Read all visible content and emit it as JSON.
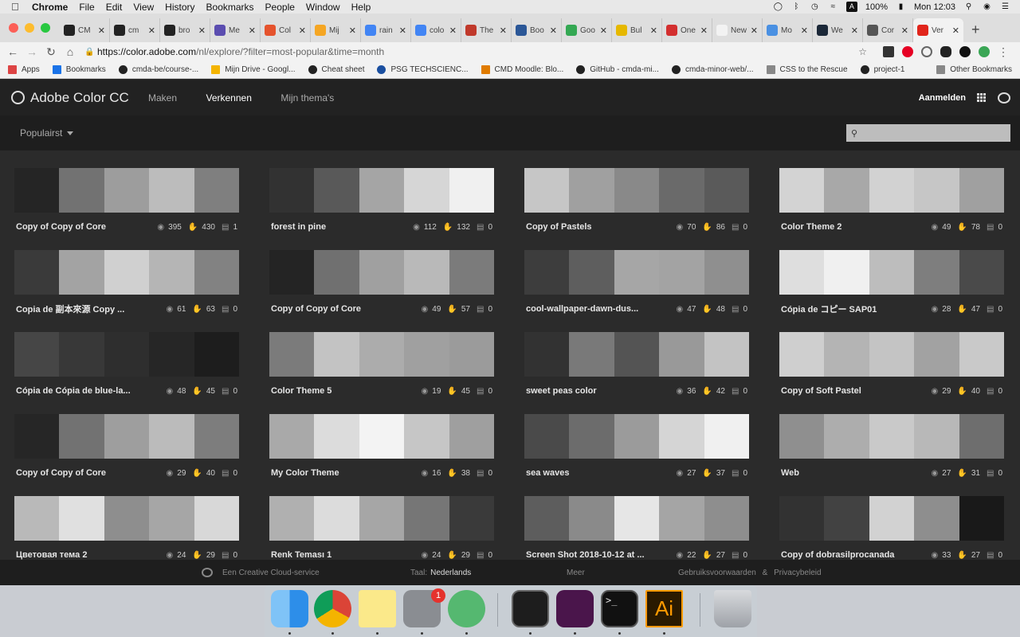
{
  "menubar": {
    "app": "Chrome",
    "items": [
      "File",
      "Edit",
      "View",
      "History",
      "Bookmarks",
      "People",
      "Window",
      "Help"
    ],
    "battery": "100%",
    "clock": "Mon 12:03"
  },
  "tabs": [
    {
      "label": "CM",
      "color": "#222"
    },
    {
      "label": "cm",
      "color": "#222"
    },
    {
      "label": "bro",
      "color": "#222"
    },
    {
      "label": "Me",
      "color": "#5b4db0"
    },
    {
      "label": "Col",
      "color": "#e5532d"
    },
    {
      "label": "Mij",
      "color": "#f5a623"
    },
    {
      "label": "rain",
      "color": "#4285f4"
    },
    {
      "label": "colo",
      "color": "#4285f4"
    },
    {
      "label": "The",
      "color": "#c0392b"
    },
    {
      "label": "Boo",
      "color": "#2b5797"
    },
    {
      "label": "Goo",
      "color": "#34a853"
    },
    {
      "label": "Bul",
      "color": "#e6b800"
    },
    {
      "label": "One",
      "color": "#d32f2f"
    },
    {
      "label": "New Tab",
      "color": "#f2f2f2"
    },
    {
      "label": "Mo",
      "color": "#4a90e2"
    },
    {
      "label": "We",
      "color": "#1b2838"
    },
    {
      "label": "Cor",
      "color": "#555"
    },
    {
      "label": "Ver",
      "color": "#e1251b"
    }
  ],
  "address": {
    "host": "https://color.adobe.com",
    "path": "/nl/explore/?filter=most-popular&time=month"
  },
  "bookmarks": [
    "Apps",
    "Bookmarks",
    "cmda-be/course-...",
    "Mijn Drive - Googl...",
    "Cheat sheet",
    "PSG TECHSCIENC...",
    "CMD Moodle: Blo...",
    "GitHub - cmda-mi...",
    "cmda-minor-web/...",
    "CSS to the Rescue",
    "project-1"
  ],
  "other_bookmarks": "Other Bookmarks",
  "app": {
    "title": "Adobe Color CC",
    "nav": [
      "Maken",
      "Verkennen",
      "Mijn thema's"
    ],
    "login": "Aanmelden",
    "filter": "Populairst",
    "search_placeholder": ""
  },
  "themes": [
    {
      "name": "Copy of Copy of Core",
      "views": "395",
      "likes": "430",
      "comments": "1",
      "colors": [
        "#252525",
        "#727272",
        "#9d9d9d",
        "#bcbcbc",
        "#7f7f7f"
      ]
    },
    {
      "name": "forest in pine",
      "views": "112",
      "likes": "132",
      "comments": "0",
      "colors": [
        "#323232",
        "#595959",
        "#a5a5a5",
        "#d6d6d6",
        "#f0f0f0"
      ]
    },
    {
      "name": "Copy of Pastels",
      "views": "70",
      "likes": "86",
      "comments": "0",
      "colors": [
        "#c6c6c6",
        "#a0a0a0",
        "#898989",
        "#6a6a6a",
        "#5a5a5a"
      ]
    },
    {
      "name": "Color Theme 2",
      "views": "49",
      "likes": "78",
      "comments": "0",
      "colors": [
        "#d3d3d3",
        "#a8a8a8",
        "#d2d2d2",
        "#c6c6c6",
        "#a0a0a0"
      ]
    },
    {
      "name": "Copia de 副本來源 Copy ...",
      "views": "61",
      "likes": "63",
      "comments": "0",
      "colors": [
        "#3a3a3a",
        "#a3a3a3",
        "#d0d0d0",
        "#b5b5b5",
        "#828282"
      ]
    },
    {
      "name": "Copy of Copy of Core",
      "views": "49",
      "likes": "57",
      "comments": "0",
      "colors": [
        "#242424",
        "#707070",
        "#a0a0a0",
        "#b9b9b9",
        "#7b7b7b"
      ]
    },
    {
      "name": "cool-wallpaper-dawn-dus...",
      "views": "47",
      "likes": "48",
      "comments": "0",
      "colors": [
        "#3d3d3d",
        "#5e5e5e",
        "#a6a6a6",
        "#a3a3a3",
        "#8f8f8f"
      ]
    },
    {
      "name": "Cópia de コピー SAP01",
      "views": "28",
      "likes": "47",
      "comments": "0",
      "colors": [
        "#dedede",
        "#f0f0f0",
        "#bdbdbd",
        "#7e7e7e",
        "#4a4a4a"
      ]
    },
    {
      "name": "Cópia de Cópia de blue-la...",
      "views": "48",
      "likes": "45",
      "comments": "0",
      "colors": [
        "#464646",
        "#383838",
        "#2e2e2e",
        "#262626",
        "#1d1d1d"
      ]
    },
    {
      "name": "Color Theme 5",
      "views": "19",
      "likes": "45",
      "comments": "0",
      "colors": [
        "#7b7b7b",
        "#c3c3c3",
        "#acacac",
        "#a0a0a0",
        "#9b9b9b"
      ]
    },
    {
      "name": "sweet peas color",
      "views": "36",
      "likes": "42",
      "comments": "0",
      "colors": [
        "#323232",
        "#797979",
        "#545454",
        "#999999",
        "#c3c3c3"
      ]
    },
    {
      "name": "Copy of Soft Pastel",
      "views": "29",
      "likes": "40",
      "comments": "0",
      "colors": [
        "#cfcfcf",
        "#b4b4b4",
        "#c4c4c4",
        "#a2a2a2",
        "#c9c9c9"
      ]
    },
    {
      "name": "Copy of Copy of Core",
      "views": "29",
      "likes": "40",
      "comments": "0",
      "colors": [
        "#262626",
        "#727272",
        "#9e9e9e",
        "#bbbbbb",
        "#7d7d7d"
      ]
    },
    {
      "name": "My Color Theme",
      "views": "16",
      "likes": "38",
      "comments": "0",
      "colors": [
        "#a9a9a9",
        "#dcdcdc",
        "#f3f3f3",
        "#c6c6c6",
        "#9f9f9f"
      ]
    },
    {
      "name": "sea waves",
      "views": "27",
      "likes": "37",
      "comments": "0",
      "colors": [
        "#4a4a4a",
        "#6c6c6c",
        "#9b9b9b",
        "#d5d5d5",
        "#f0f0f0"
      ]
    },
    {
      "name": "Web",
      "views": "27",
      "likes": "31",
      "comments": "0",
      "colors": [
        "#8f8f8f",
        "#adadad",
        "#c9c9c9",
        "#b8b8b8",
        "#6e6e6e"
      ]
    },
    {
      "name": "Цветовая тема 2",
      "views": "24",
      "likes": "29",
      "comments": "0",
      "colors": [
        "#b9b9b9",
        "#e0e0e0",
        "#8e8e8e",
        "#a6a6a6",
        "#d8d8d8"
      ]
    },
    {
      "name": "Renk Teması 1",
      "views": "24",
      "likes": "29",
      "comments": "0",
      "colors": [
        "#b0b0b0",
        "#dcdcdc",
        "#a6a6a6",
        "#767676",
        "#3a3a3a"
      ]
    },
    {
      "name": "Screen Shot 2018-10-12 at ...",
      "views": "22",
      "likes": "27",
      "comments": "0",
      "colors": [
        "#5d5d5d",
        "#8a8a8a",
        "#e6e6e6",
        "#a5a5a5",
        "#8e8e8e"
      ]
    },
    {
      "name": "Copy of dobrasilprocanada",
      "views": "33",
      "likes": "27",
      "comments": "0",
      "colors": [
        "#323232",
        "#424242",
        "#d2d2d2",
        "#8e8e8e",
        "#191919"
      ]
    }
  ],
  "footer": {
    "cc_service": "Een Creative Cloud-service",
    "lang_label": "Taal:",
    "lang_value": "Nederlands",
    "more": "Meer",
    "terms": "Gebruiksvoorwaarden",
    "amp": "&",
    "privacy": "Privacybeleid"
  },
  "dock": {
    "system_prefs_badge": "1",
    "illustrator_label": "Ai",
    "terminal_label": ">_"
  }
}
